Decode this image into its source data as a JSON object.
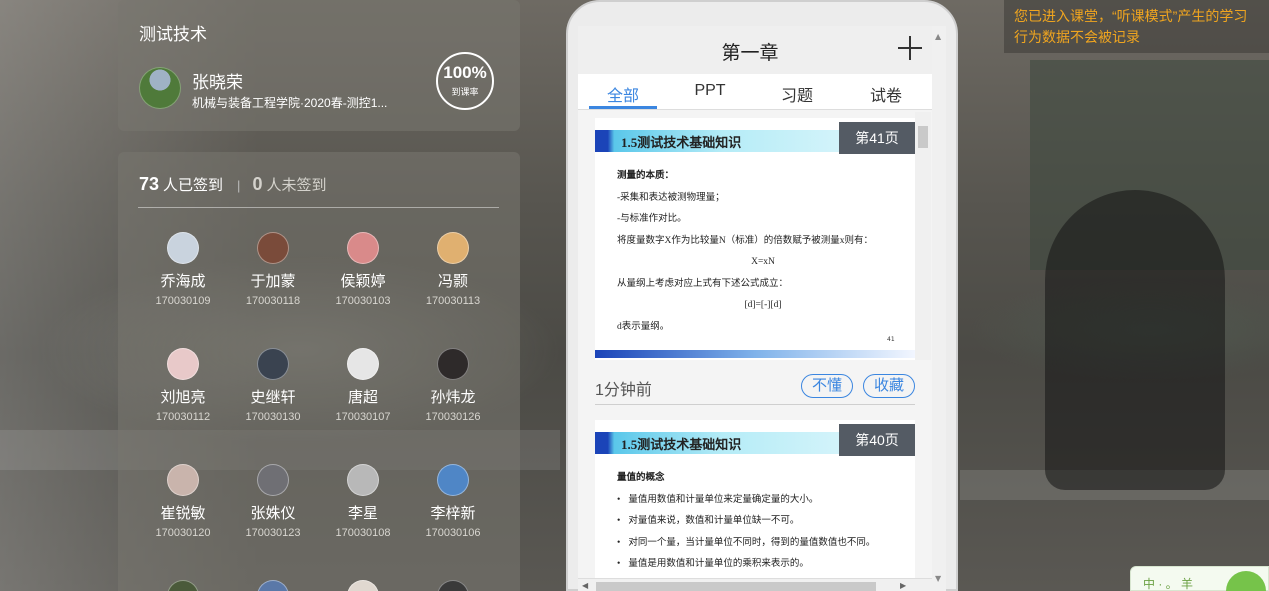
{
  "course": {
    "title": "测试技术",
    "teacher_name": "张晓荣",
    "class_info": "机械与装备工程学院·2020春-测控1...",
    "attendance_rate": "100%",
    "attendance_rate_label": "到课率"
  },
  "attendance": {
    "signed_count": "73",
    "signed_label": "人已签到",
    "separator": "|",
    "unsigned_count": "0",
    "unsigned_label": "人未签到",
    "students": [
      {
        "name": "乔海成",
        "id": "170030109",
        "color": "#c9d3de"
      },
      {
        "name": "于加蒙",
        "id": "170030118",
        "color": "#7a4b3a"
      },
      {
        "name": "侯颖婷",
        "id": "170030103",
        "color": "#d98a8a"
      },
      {
        "name": "冯颢",
        "id": "170030113",
        "color": "#e0b070"
      },
      {
        "name": "刘旭亮",
        "id": "170030112",
        "color": "#e8c9c9"
      },
      {
        "name": "史继轩",
        "id": "170030130",
        "color": "#3a4350"
      },
      {
        "name": "唐超",
        "id": "170030107",
        "color": "#e6e6e6"
      },
      {
        "name": "孙炜龙",
        "id": "170030126",
        "color": "#2e2a2a"
      },
      {
        "name": "崔锐敏",
        "id": "170030120",
        "color": "#c9b4ac"
      },
      {
        "name": "张姝仪",
        "id": "170030123",
        "color": "#6f6f74"
      },
      {
        "name": "李星",
        "id": "170030108",
        "color": "#b8b8b8"
      },
      {
        "name": "李梓新",
        "id": "170030106",
        "color": "#4f86c6"
      }
    ]
  },
  "phone": {
    "chapter_title": "第一章",
    "tabs": [
      {
        "label": "全部",
        "active": true
      },
      {
        "label": "PPT",
        "active": false
      },
      {
        "label": "习题",
        "active": false
      },
      {
        "label": "试卷",
        "active": false
      }
    ],
    "slide1": {
      "title": "1.5测试技术基础知识",
      "page": "第41页",
      "lines": [
        "测量的本质：",
        "-采集和表达被测物理量；",
        "-与标准作对比。",
        "将度量数字X作为比较量N（标准）的倍数赋予被测量x则有：",
        "X=xN",
        "从量纲上考虑对应上式有下述公式成立：",
        "[d]=[-][d]",
        "d表示量纲。"
      ],
      "page_number": "41"
    },
    "meta": {
      "time": "1分钟前",
      "button_dont_understand": "不懂",
      "button_favorite": "收藏"
    },
    "slide2": {
      "title": "1.5测试技术基础知识",
      "page": "第40页",
      "heading": "量值的概念",
      "bullets": [
        "量值用数值和计量单位来定量确定量的大小。",
        "对量值来说，数值和计量单位缺一不可。",
        "对同一个量，当计量单位不同时，得到的量值数值也不同。",
        "量值是用数值和计量单位的乘积来表示的。"
      ]
    }
  },
  "notice": {
    "text": "您已进入课堂，“听课模式”产生的学习行为数据不会被记录"
  },
  "corner_widget": {
    "text": "中 · 。 羊"
  }
}
